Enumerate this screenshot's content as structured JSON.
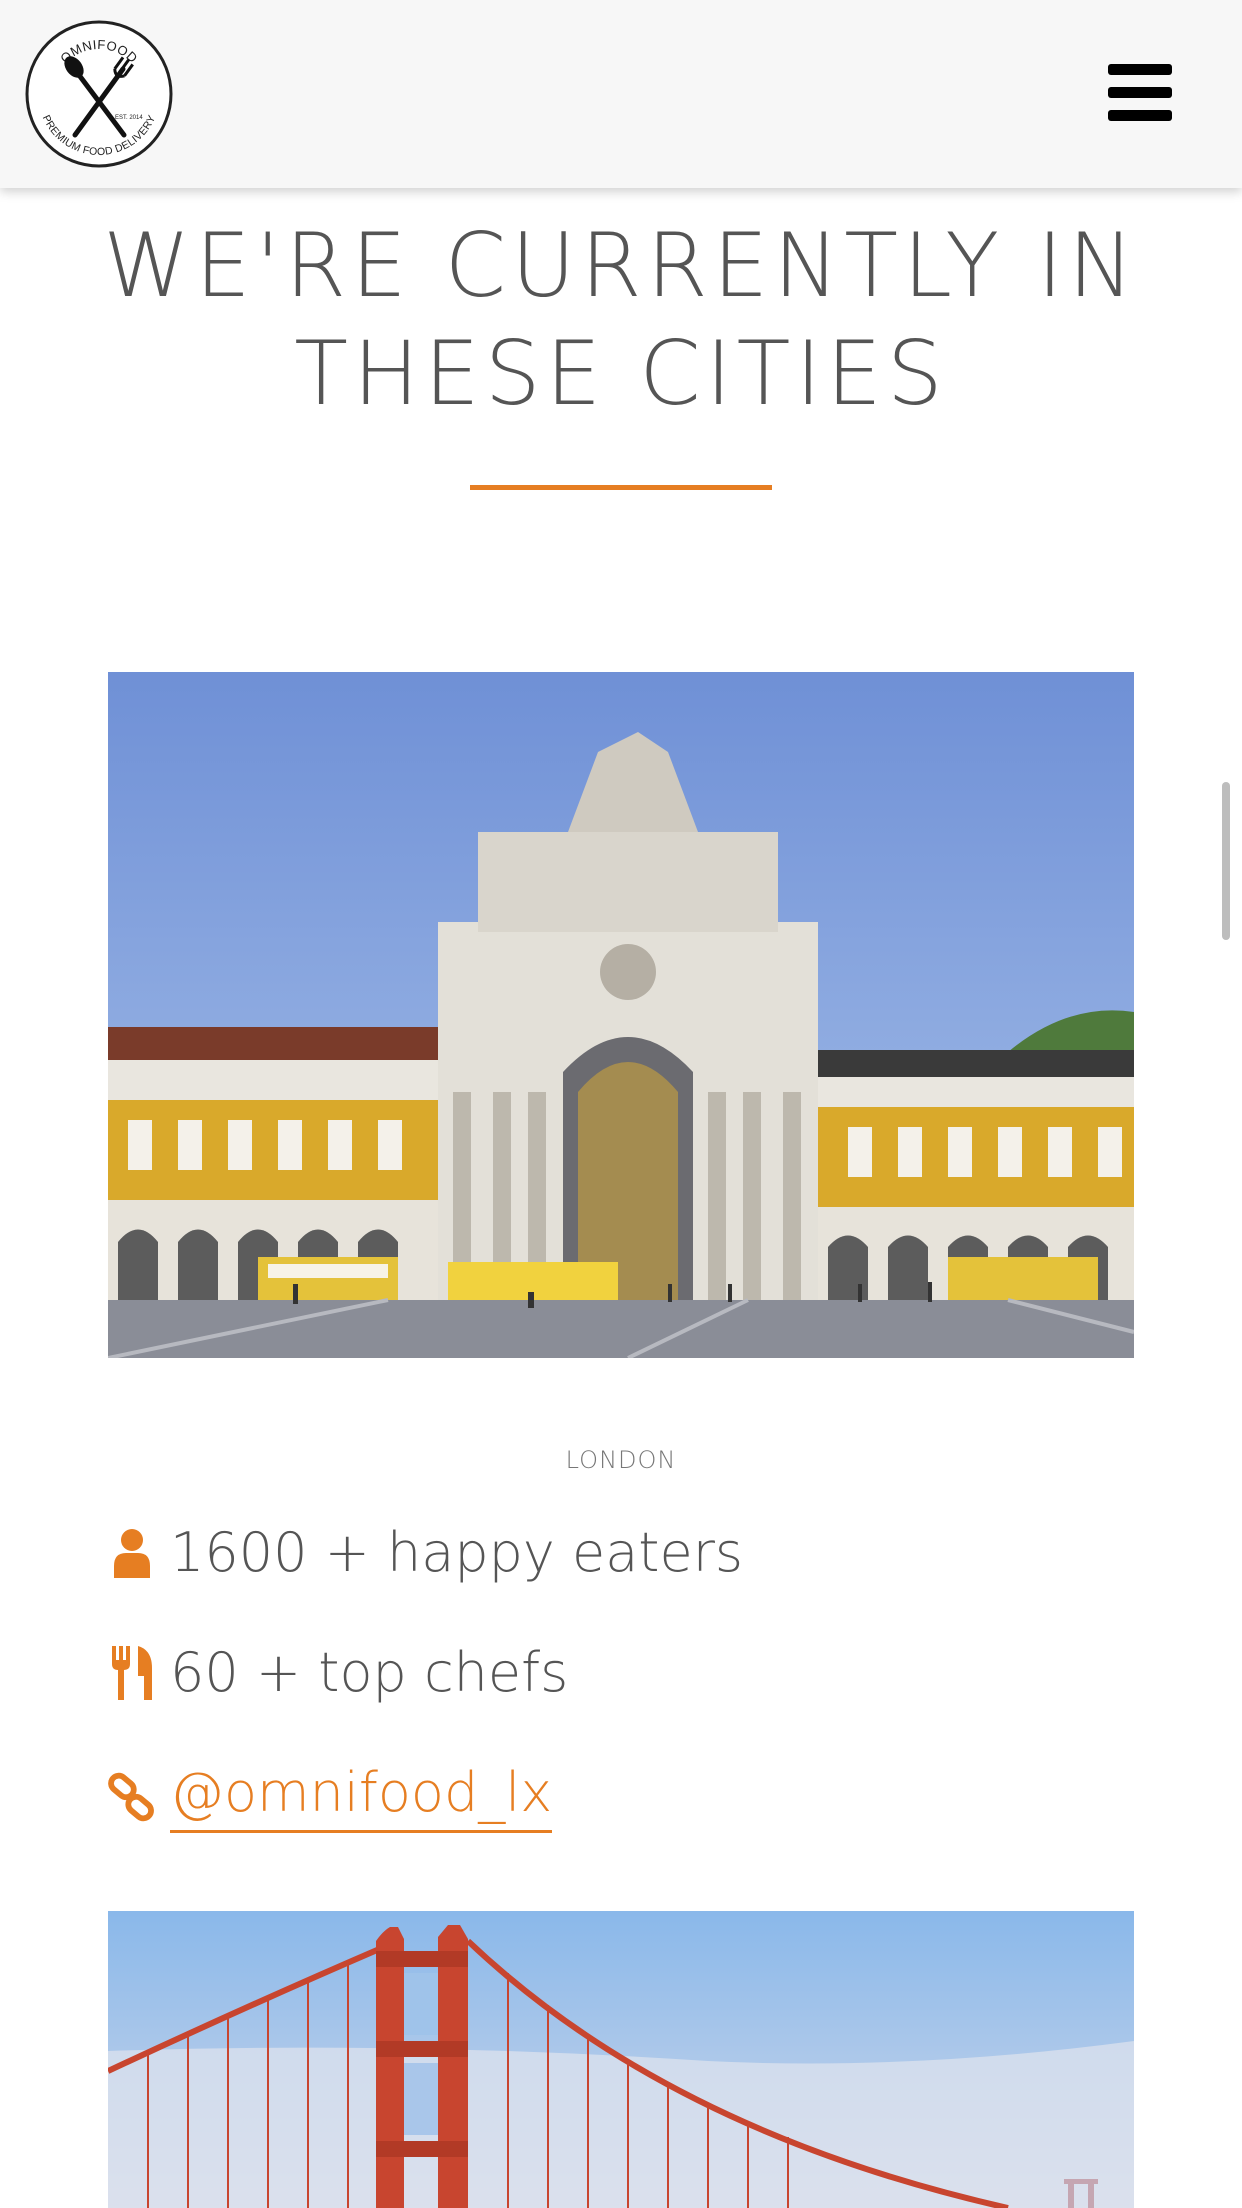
{
  "header": {
    "logo": {
      "top_text": "OMNIFOOD",
      "bottom_text": "PREMIUM FOOD DELIVERY",
      "est": "EST. 2014",
      "icon": "spoon-fork-icon"
    },
    "menu_icon": "hamburger-menu-icon"
  },
  "section": {
    "title_line1": "WE'RE CURRENTLY IN",
    "title_line2": "THESE CITIES",
    "accent_color": "#e67e22"
  },
  "cities": [
    {
      "name": "LONDON",
      "features": [
        {
          "icon": "person-icon",
          "text": "1600 + happy eaters"
        },
        {
          "icon": "cutlery-icon",
          "text": "60 + top chefs"
        },
        {
          "icon": "link-icon",
          "text": "@omnifood_lx"
        }
      ]
    }
  ]
}
